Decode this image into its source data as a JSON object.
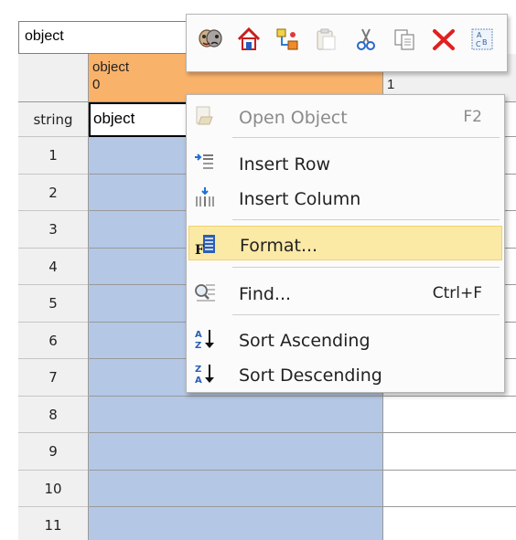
{
  "name_box": {
    "value": "object"
  },
  "column_headers": [
    {
      "type": "object",
      "index": "0"
    },
    {
      "type": "",
      "index": "1"
    }
  ],
  "type_row": {
    "label": "string",
    "value": "object"
  },
  "row_numbers": [
    "1",
    "2",
    "3",
    "4",
    "5",
    "6",
    "7",
    "8",
    "9",
    "10",
    "11"
  ],
  "toolbar": {
    "buttons": [
      {
        "icon": "mask-icon"
      },
      {
        "icon": "home-icon"
      },
      {
        "icon": "link-objects-icon"
      },
      {
        "icon": "paste-icon"
      },
      {
        "icon": "scissors-icon"
      },
      {
        "icon": "copy-icon"
      },
      {
        "icon": "delete-icon"
      },
      {
        "icon": "rename-icon"
      }
    ]
  },
  "context_menu": {
    "items": [
      {
        "label": "Open Object",
        "shortcut": "F2",
        "disabled": true
      },
      {
        "label": "Insert Row",
        "shortcut": ""
      },
      {
        "label": "Insert Column",
        "shortcut": ""
      },
      {
        "label": "Format...",
        "shortcut": "",
        "highlighted": true
      },
      {
        "label": "Find...",
        "shortcut": "Ctrl+F"
      },
      {
        "label": "Sort Ascending",
        "shortcut": ""
      },
      {
        "label": "Sort Descending",
        "shortcut": ""
      }
    ]
  },
  "colors": {
    "selected_column": "#b4c8e6",
    "header_highlight": "#f9b26a",
    "menu_highlight": "#fbe9a6"
  }
}
